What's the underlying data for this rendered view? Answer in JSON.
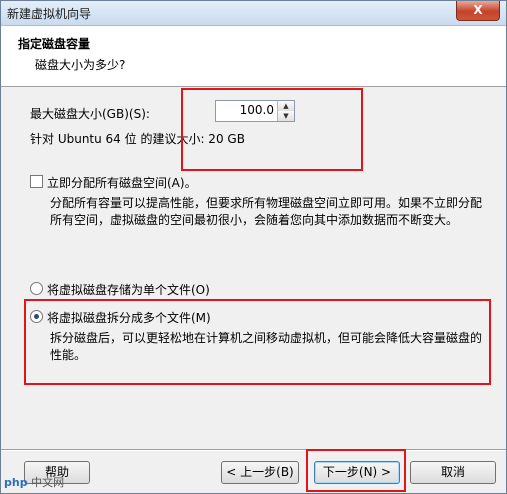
{
  "window": {
    "title": "新建虚拟机向导",
    "close_label": "X"
  },
  "header": {
    "title": "指定磁盘容量",
    "subtitle": "磁盘大小为多少?"
  },
  "max_size": {
    "label": "最大磁盘大小(GB)(S):",
    "value": "100.0",
    "recommended": "针对 Ubuntu 64 位 的建议大小: 20 GB"
  },
  "allocate": {
    "label": "立即分配所有磁盘空间(A)。",
    "checked": false,
    "desc_line1": "分配所有容量可以提高性能，但要求所有物理磁盘空间立即可用。如果不立即分配",
    "desc_line2": "所有空间，虚拟磁盘的空间最初很小，会随着您向其中添加数据而不断变大。"
  },
  "storage": {
    "single_label": "将虚拟磁盘存储为单个文件(O)",
    "split_label": "将虚拟磁盘拆分成多个文件(M)",
    "selected": "split",
    "split_desc_line1": "拆分磁盘后，可以更轻松地在计算机之间移动虚拟机，但可能会降低大容量磁盘的",
    "split_desc_line2": "性能。"
  },
  "buttons": {
    "help": "帮助",
    "back": "< 上一步(B)",
    "next": "下一步(N) >",
    "cancel": "取消"
  },
  "watermark": {
    "brand": "php",
    "text": "中文网"
  },
  "colors": {
    "highlight": "#e0151b"
  }
}
